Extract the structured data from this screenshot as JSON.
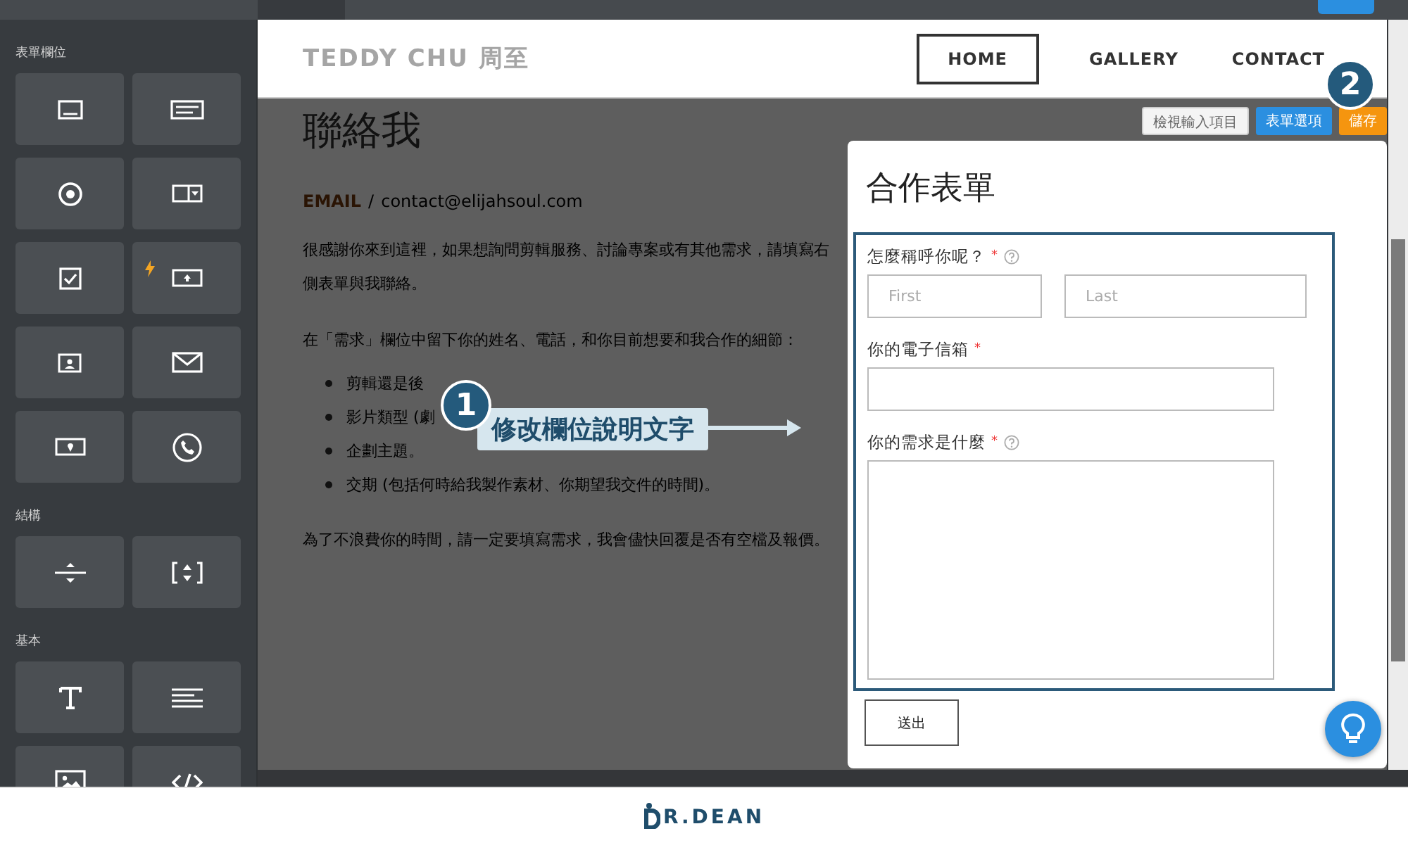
{
  "top_bar": {
    "active_tab": true,
    "publish_button": true
  },
  "sidebar": {
    "sections": [
      {
        "title": "表單欄位",
        "tiles": [
          {
            "kind": "single-line"
          },
          {
            "kind": "paragraph"
          },
          {
            "kind": "radio"
          },
          {
            "kind": "dropdown"
          },
          {
            "kind": "checkbox"
          },
          {
            "kind": "upload",
            "premium": true
          },
          {
            "kind": "contact-card"
          },
          {
            "kind": "email"
          },
          {
            "kind": "address"
          },
          {
            "kind": "phone"
          }
        ]
      },
      {
        "title": "結構",
        "tiles": [
          {
            "kind": "divider"
          },
          {
            "kind": "spacer"
          }
        ]
      },
      {
        "title": "基本",
        "tiles": [
          {
            "kind": "text"
          },
          {
            "kind": "paragraph-text"
          },
          {
            "kind": "image"
          },
          {
            "kind": "code"
          }
        ]
      }
    ]
  },
  "site": {
    "brand": "TEDDY CHU 周至",
    "nav": [
      {
        "label": "HOME",
        "selected": true
      },
      {
        "label": "GALLERY",
        "selected": false
      },
      {
        "label": "CONTACT",
        "selected": false
      }
    ]
  },
  "toolbar": [
    {
      "label": "檢視輸入項目",
      "kind": "secondary"
    },
    {
      "label": "表單選項",
      "kind": "primary"
    },
    {
      "label": "儲存",
      "kind": "save"
    }
  ],
  "content": {
    "heading": "聯絡我",
    "email_label": "EMAIL",
    "separator": "/",
    "email": "contact@elijahsoul.com",
    "paragraphs": [
      "很感謝你來到這裡，如果想詢問剪輯服務、討論專案或有其他需求，請填寫右側表單與我聯絡。",
      "在「需求」欄位中留下你的姓名、電話，和你目前想要和我合作的細節："
    ],
    "bullets": [
      "剪輯還是後",
      "影片類型 (劇",
      "企劃主題。",
      "交期 (包括何時給我製作素材、你期望我交件的時間)。"
    ],
    "closing": "為了不浪費你的時間，請一定要填寫需求，我會儘快回覆是否有空檔及報價。"
  },
  "form": {
    "title": "合作表單",
    "highlighted": true,
    "fields": [
      {
        "kind": "name",
        "label": "怎麼稱呼你呢？",
        "required_mark": "*",
        "help": true,
        "placeholders": [
          "First",
          "Last"
        ]
      },
      {
        "kind": "email",
        "label": "你的電子信箱",
        "required_mark": "*",
        "help": false
      },
      {
        "kind": "textarea",
        "label": "你的需求是什麼",
        "required_mark": "*",
        "help": true
      }
    ],
    "submit": "送出"
  },
  "annotations": [
    {
      "number": "1",
      "text": "修改欄位說明文字"
    },
    {
      "number": "2"
    }
  ],
  "footer": {
    "logo": "R.DEAN"
  }
}
